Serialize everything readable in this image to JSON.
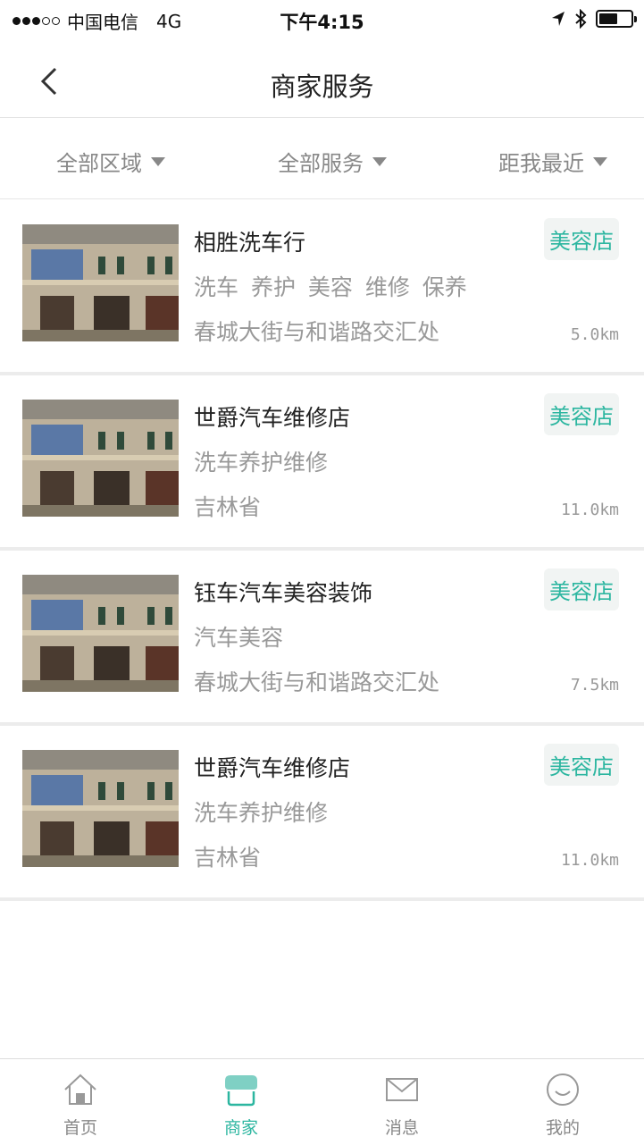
{
  "status_bar": {
    "carrier": "中国电信",
    "network": "4G",
    "time": "下午4:15",
    "signal_strength": 3,
    "battery_level": 0.6
  },
  "nav": {
    "title": "商家服务",
    "back_icon": "chevron-left-icon"
  },
  "filters": [
    {
      "label": "全部区域"
    },
    {
      "label": "全部服务"
    },
    {
      "label": "距我最近"
    }
  ],
  "shops": [
    {
      "name": "相胜洗车行",
      "services": "洗车 养护 美容 维修 保养",
      "address": "春城大街与和谐路交汇处",
      "tag": "美容店",
      "distance": "5.0km"
    },
    {
      "name": "世爵汽车维修店",
      "services": "洗车养护维修",
      "address": "吉林省",
      "tag": "美容店",
      "distance": "11.0km"
    },
    {
      "name": "钰车汽车美容装饰",
      "services": "汽车美容",
      "address": "春城大街与和谐路交汇处",
      "tag": "美容店",
      "distance": "7.5km"
    },
    {
      "name": "世爵汽车维修店",
      "services": "洗车养护维修",
      "address": "吉林省",
      "tag": "美容店",
      "distance": "11.0km"
    }
  ],
  "tabs": [
    {
      "label": "首页",
      "icon": "home-icon"
    },
    {
      "label": "商家",
      "icon": "store-icon"
    },
    {
      "label": "消息",
      "icon": "mail-icon"
    },
    {
      "label": "我的",
      "icon": "smiley-icon"
    }
  ],
  "colors": {
    "accent": "#2cb6a0",
    "tag_bg": "#f1f4f3"
  }
}
